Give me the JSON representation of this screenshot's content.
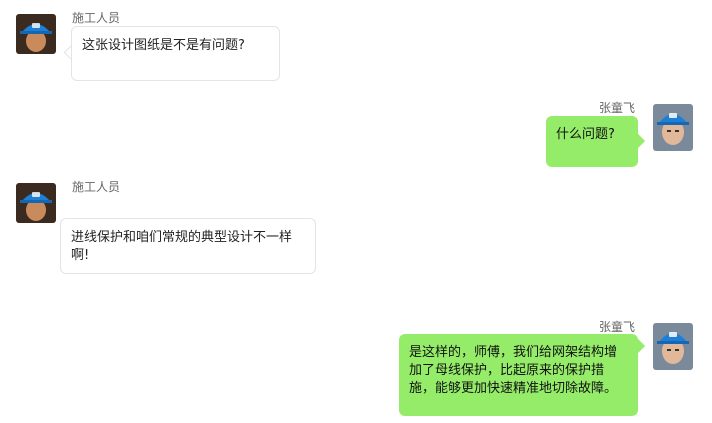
{
  "colors": {
    "self_bubble": "#95ec69",
    "other_bubble": "#ffffff",
    "hard_hat": "#1e7fd6"
  },
  "messages": [
    {
      "sender": "施工人员",
      "side": "left",
      "avatar": "worker-avatar",
      "text": "这张设计图纸是不是有问题?"
    },
    {
      "sender": "张童飞",
      "side": "right",
      "avatar": "engineer-avatar",
      "text": "什么问题?"
    },
    {
      "sender": "施工人员",
      "side": "left",
      "avatar": "worker-avatar",
      "text": "进线保护和咱们常规的典型设计不一样啊!"
    },
    {
      "sender": "张童飞",
      "side": "right",
      "avatar": "engineer-avatar",
      "text": "是这样的，师傅，我们给网架结构增加了母线保护，比起原来的保护措施，能够更加快速精准地切除故障。"
    }
  ]
}
